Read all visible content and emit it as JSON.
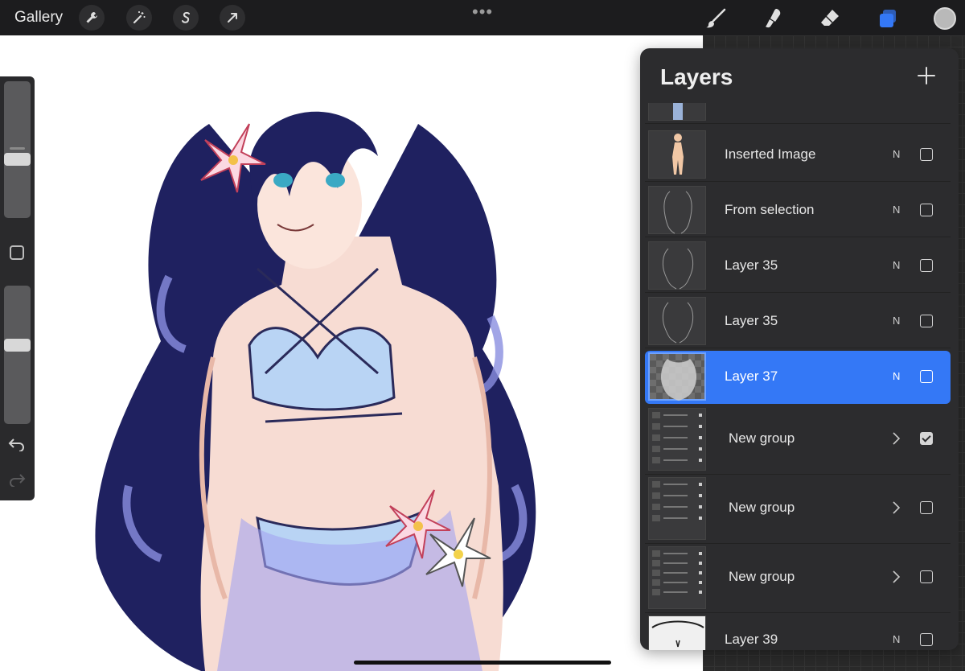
{
  "topbar": {
    "gallery_label": "Gallery",
    "tools_left": [
      "wrench-icon",
      "magic-wand-icon",
      "selection-s-icon",
      "transform-arrow-icon"
    ],
    "more_label": "•••",
    "tools_right": [
      "brush-icon",
      "smudge-icon",
      "eraser-icon",
      "layers-icon"
    ],
    "color_hex": "#b9b9b9",
    "active_tool_color": "#3478f6"
  },
  "sidebar": {
    "brush_size_level": 0.42,
    "opacity_level": 0.58
  },
  "layers_panel": {
    "title": "Layers",
    "items": [
      {
        "name": "Inserted Image",
        "mode": "N",
        "checked": false,
        "type": "layer"
      },
      {
        "name": "From selection",
        "mode": "N",
        "checked": false,
        "type": "layer"
      },
      {
        "name": "Layer 35",
        "mode": "N",
        "checked": false,
        "type": "layer"
      },
      {
        "name": "Layer 35",
        "mode": "N",
        "checked": false,
        "type": "layer"
      },
      {
        "name": "Layer 37",
        "mode": "N",
        "checked": false,
        "type": "layer",
        "selected": true
      },
      {
        "name": "New group",
        "checked": true,
        "type": "group"
      },
      {
        "name": "New group",
        "checked": false,
        "type": "group"
      },
      {
        "name": "New group",
        "checked": false,
        "type": "group"
      },
      {
        "name": "Layer 39",
        "mode": "N",
        "checked": false,
        "type": "layer"
      }
    ]
  }
}
